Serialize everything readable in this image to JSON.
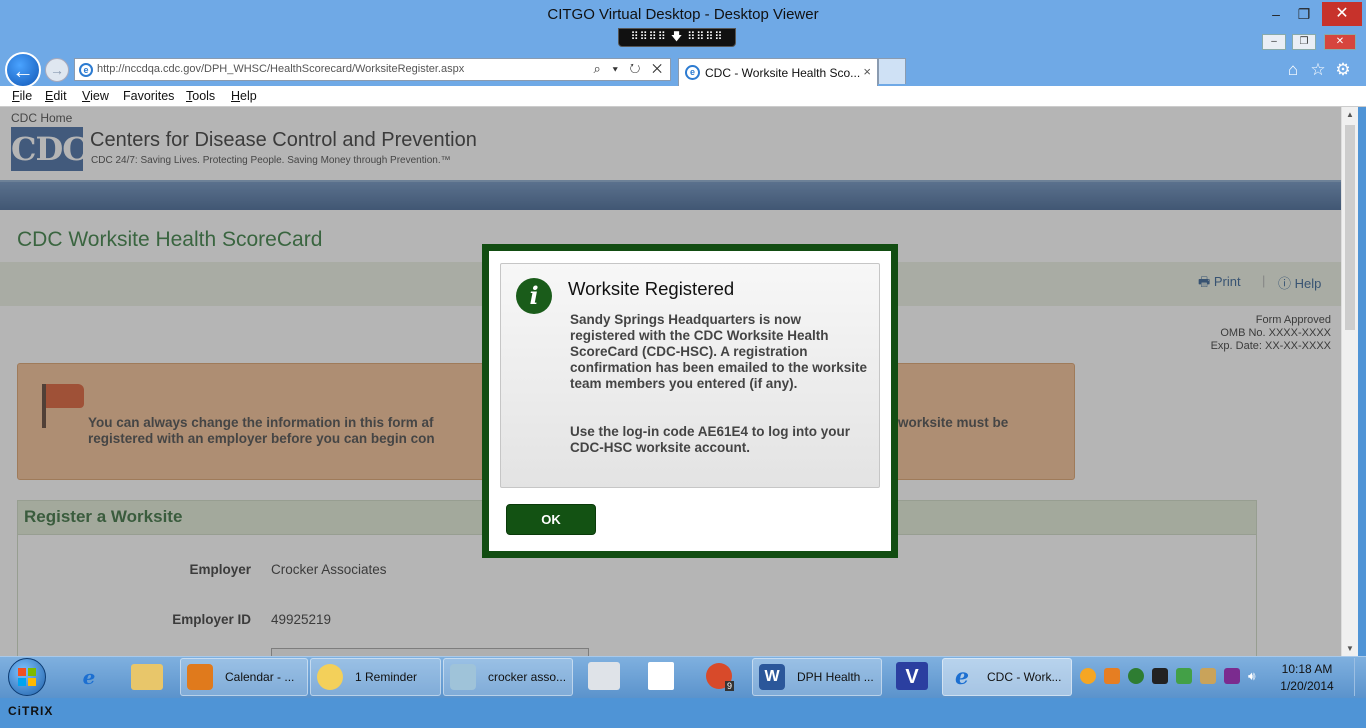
{
  "window": {
    "title": "CITGO Virtual Desktop - Desktop Viewer",
    "minimize": "‒",
    "restore": "❐",
    "close": "✕",
    "grip": "⠿⠿⠿⠿ 🡇 ⠿⠿⠿⠿"
  },
  "ie": {
    "window_min": "–",
    "window_max": "❐",
    "window_close": "✕",
    "back": "←",
    "forward": "→",
    "address": "http://nccdqa.cdc.gov/DPH_WHSC/HealthScorecard/WorksiteRegister.aspx",
    "address_tools": "⌕ ▾ ↻ ✕",
    "tab_title": "CDC - Worksite Health Sco...",
    "tab_close": "×",
    "home_icon": "⌂",
    "star_icon": "☆",
    "gear_icon": "⚙",
    "menu": [
      {
        "key": "F",
        "rest": "ile"
      },
      {
        "key": "E",
        "rest": "dit"
      },
      {
        "key": "V",
        "rest": "iew"
      },
      {
        "key": "",
        "rest": "Favorites",
        "ul": "F"
      },
      {
        "key": "T",
        "rest": "ools"
      },
      {
        "key": "H",
        "rest": "elp"
      }
    ]
  },
  "page": {
    "cdc_home": "CDC Home",
    "logo_text": "CDC",
    "org_name": "Centers for Disease Control and Prevention",
    "tagline": "CDC 24/7: Saving Lives. Protecting People. Saving Money through Prevention.™",
    "heading": "CDC Worksite Health ScoreCard",
    "print": "Print",
    "help": "Help",
    "form_approved": "Form Approved",
    "omb": "OMB No. XXXX-XXXX",
    "exp": "Exp. Date: XX-XX-XXXX",
    "notice_line1": "You can always change the information in this form af",
    "notice_line2": "registered with an employer before you can begin con",
    "notice_line1_end": "worksite must be",
    "register_title": "Register a Worksite",
    "employer_label": "Employer",
    "employer_value": "Crocker Associates",
    "employer_id_label": "Employer ID",
    "employer_id_value": "49925219"
  },
  "modal": {
    "title": "Worksite Registered",
    "body": "Sandy Springs Headquarters is now registered with the CDC Worksite Health ScoreCard (CDC-HSC). A registration confirmation has been emailed to the worksite team members you entered (if any).",
    "code_text": "Use the log-in code AE61E4 to log into your CDC-HSC worksite account.",
    "ok": "OK",
    "icon": "i"
  },
  "taskbar": {
    "items": [
      {
        "label": "Calendar - ..."
      },
      {
        "label": "1 Reminder"
      },
      {
        "label": "crocker asso..."
      },
      {
        "label": "DPH Health ..."
      },
      {
        "label": "CDC - Work..."
      }
    ],
    "clock_time": "10:18 AM",
    "clock_date": "1/20/2014",
    "badge": "9"
  },
  "citrix": "CiTRIX",
  "colors": {
    "accent_green": "#124d12",
    "taskbar": "#5b93cc",
    "cdc_blue": "#2e5a97"
  }
}
